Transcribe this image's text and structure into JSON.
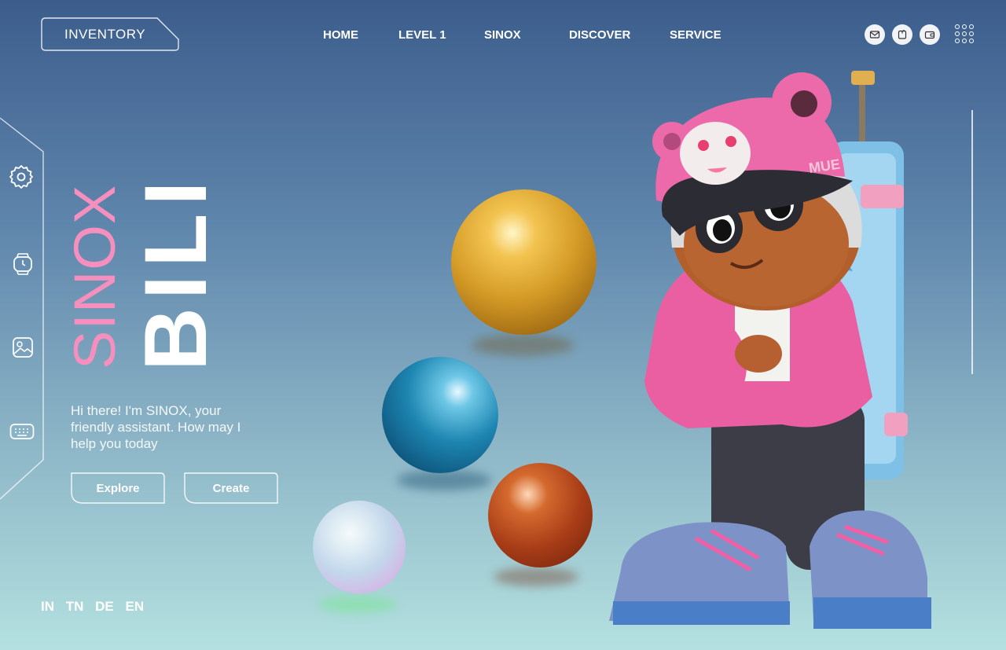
{
  "header": {
    "inventory_label": "INVENTORY",
    "nav": [
      "HOME",
      "LEVEL 1",
      "SINOX",
      "DISCOVER",
      "SERVICE"
    ],
    "icons": [
      "mail-icon",
      "calendar-icon",
      "wallet-icon",
      "apps-grid-icon"
    ]
  },
  "sidebar": {
    "icons": [
      "settings-icon",
      "watch-icon",
      "gallery-icon",
      "keyboard-icon"
    ]
  },
  "hero": {
    "title_small": "SINOX",
    "title_big": "BILI",
    "intro": "Hi there! I'm SINOX, your friendly assistant. How may I help you today",
    "buttons": {
      "explore": "Explore",
      "create": "Create"
    }
  },
  "languages": [
    "IN",
    "TN",
    "DE",
    "EN"
  ],
  "colors": {
    "accent_pink": "#f58fbe",
    "bg_top": "#3c5d8c",
    "bg_bottom": "#b4e1e0"
  },
  "illustration": {
    "hat_text": "MUE"
  }
}
